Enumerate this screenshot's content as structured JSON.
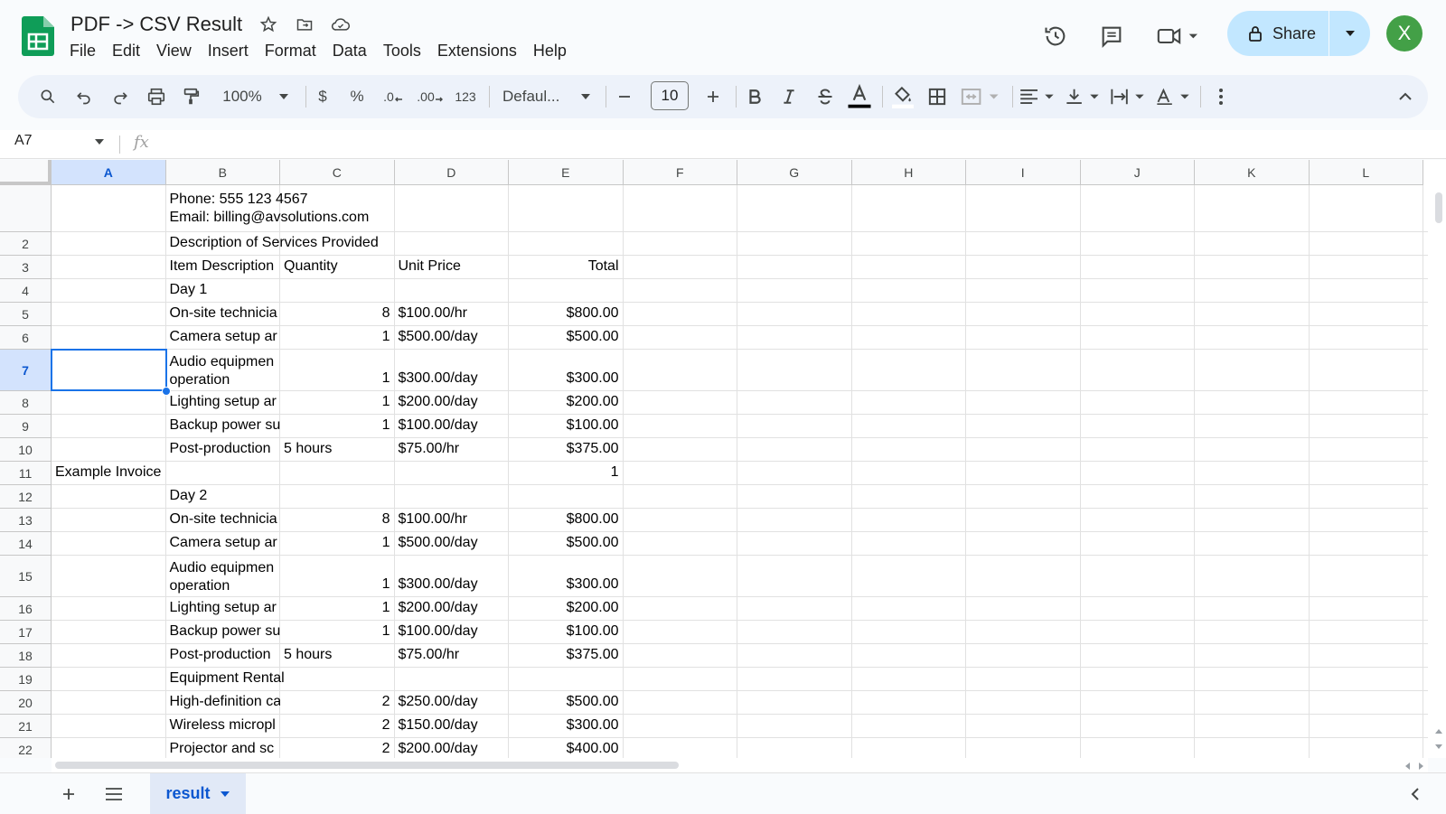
{
  "app": {
    "doc_title": "PDF -> CSV Result",
    "menu": [
      "File",
      "Edit",
      "View",
      "Insert",
      "Format",
      "Data",
      "Tools",
      "Extensions",
      "Help"
    ],
    "share_label": "Share",
    "avatar_letter": "X"
  },
  "toolbar": {
    "zoom": "100%",
    "currency": "$",
    "percent": "%",
    "dec_decrease": ".0",
    "dec_increase": ".00",
    "number_format": "123",
    "font": "Defaul...",
    "font_size": "10"
  },
  "formula": {
    "cell_ref": "A7",
    "fx": "fx",
    "content": ""
  },
  "grid": {
    "columns": [
      "A",
      "B",
      "C",
      "D",
      "E",
      "F",
      "G",
      "H",
      "I",
      "J",
      "K",
      "L"
    ],
    "selected_column": "A",
    "selected_row": "7",
    "rows": [
      {
        "num": "",
        "B": "Phone: 555 123 4567",
        "B2": "Email: billing@avsolutions.com"
      },
      {
        "num": "2",
        "B": "Description of Services Provided"
      },
      {
        "num": "3",
        "B": "Item Description",
        "C": "Quantity",
        "D": "Unit Price",
        "E": "Total"
      },
      {
        "num": "4",
        "B": "Day 1"
      },
      {
        "num": "5",
        "B": "On-site technicia",
        "C": "8",
        "D": "$100.00/hr",
        "E": "$800.00"
      },
      {
        "num": "6",
        "B": "Camera setup ar",
        "C": "1",
        "D": "$500.00/day",
        "E": "$500.00"
      },
      {
        "num": "7",
        "B": "Audio equipmen",
        "B2": "operation",
        "C": "1",
        "D": "$300.00/day",
        "E": "$300.00"
      },
      {
        "num": "8",
        "B": "Lighting setup ar",
        "C": "1",
        "D": "$200.00/day",
        "E": "$200.00"
      },
      {
        "num": "9",
        "B": "Backup power su",
        "C": "1",
        "D": "$100.00/day",
        "E": "$100.00"
      },
      {
        "num": "10",
        "B": "Post-production",
        "C": "5 hours",
        "D": "$75.00/hr",
        "E": "$375.00"
      },
      {
        "num": "11",
        "A": "Example Invoice",
        "E": "1"
      },
      {
        "num": "12",
        "B": "Day 2"
      },
      {
        "num": "13",
        "B": "On-site technicia",
        "C": "8",
        "D": "$100.00/hr",
        "E": "$800.00"
      },
      {
        "num": "14",
        "B": "Camera setup ar",
        "C": "1",
        "D": "$500.00/day",
        "E": "$500.00"
      },
      {
        "num": "15",
        "B": "Audio equipmen",
        "B2": "operation",
        "C": "1",
        "D": "$300.00/day",
        "E": "$300.00"
      },
      {
        "num": "16",
        "B": "Lighting setup ar",
        "C": "1",
        "D": "$200.00/day",
        "E": "$200.00"
      },
      {
        "num": "17",
        "B": "Backup power su",
        "C": "1",
        "D": "$100.00/day",
        "E": "$100.00"
      },
      {
        "num": "18",
        "B": "Post-production",
        "C": "5 hours",
        "D": "$75.00/hr",
        "E": "$375.00"
      },
      {
        "num": "19",
        "B": "Equipment Rental"
      },
      {
        "num": "20",
        "B": "High-definition ca",
        "C": "2",
        "D": "$250.00/day",
        "E": "$500.00"
      },
      {
        "num": "21",
        "B": "Wireless micropl",
        "C": "2",
        "D": "$150.00/day",
        "E": "$300.00"
      },
      {
        "num": "22",
        "B": "Projector and sc",
        "C": "2",
        "D": "$200.00/day",
        "E": "$400.00"
      }
    ]
  },
  "sheets": {
    "active": "result"
  },
  "colors": {
    "accent": "#1a73e8",
    "share_bg": "#c2e7ff",
    "avatar_bg": "#43a047",
    "sheets_green": "#0f9d58"
  }
}
